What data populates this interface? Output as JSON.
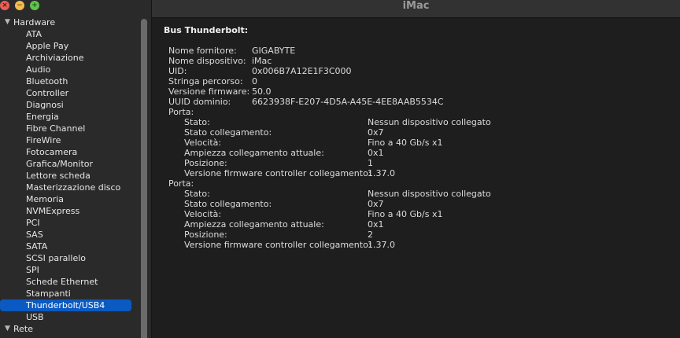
{
  "window": {
    "title": "iMac",
    "traffic": {
      "close": "×",
      "min": "−",
      "max": "+"
    }
  },
  "sidebar": {
    "hardware_label": "Hardware",
    "items": [
      "ATA",
      "Apple Pay",
      "Archiviazione",
      "Audio",
      "Bluetooth",
      "Controller",
      "Diagnosi",
      "Energia",
      "Fibre Channel",
      "FireWire",
      "Fotocamera",
      "Grafica/Monitor",
      "Lettore scheda",
      "Masterizzazione disco",
      "Memoria",
      "NVMExpress",
      "PCI",
      "SAS",
      "SATA",
      "SCSI parallelo",
      "SPI",
      "Schede Ethernet",
      "Stampanti",
      "Thunderbolt/USB4",
      "USB"
    ],
    "selected_index": 23,
    "rete_label": "Rete"
  },
  "detail": {
    "section_title": "Bus Thunderbolt:",
    "bus": [
      {
        "label": "Nome fornitore:",
        "value": "GIGABYTE"
      },
      {
        "label": "Nome dispositivo:",
        "value": "iMac"
      },
      {
        "label": "UID:",
        "value": "0x006B7A12E1F3C000"
      },
      {
        "label": "Stringa percorso:",
        "value": "0"
      },
      {
        "label": "Versione firmware:",
        "value": "50.0"
      },
      {
        "label": "UUID dominio:",
        "value": "6623938F-E207-4D5A-A45E-4EE8AAB5534C"
      }
    ],
    "ports": [
      {
        "label": "Porta:",
        "fields": [
          {
            "label": "Stato:",
            "value": "Nessun dispositivo collegato"
          },
          {
            "label": "Stato collegamento:",
            "value": "0x7"
          },
          {
            "label": "Velocità:",
            "value": "Fino a 40 Gb/s x1"
          },
          {
            "label": "Ampiezza collegamento attuale:",
            "value": "0x1"
          },
          {
            "label": "Posizione:",
            "value": "1"
          },
          {
            "label": "Versione firmware controller collegamento:",
            "value": "1.37.0"
          }
        ]
      },
      {
        "label": "Porta:",
        "fields": [
          {
            "label": "Stato:",
            "value": "Nessun dispositivo collegato"
          },
          {
            "label": "Stato collegamento:",
            "value": "0x7"
          },
          {
            "label": "Velocità:",
            "value": "Fino a 40 Gb/s x1"
          },
          {
            "label": "Ampiezza collegamento attuale:",
            "value": "0x1"
          },
          {
            "label": "Posizione:",
            "value": "2"
          },
          {
            "label": "Versione firmware controller collegamento:",
            "value": "1.37.0"
          }
        ]
      }
    ]
  },
  "colors": {
    "selection": "#0a5ac2",
    "background": "#1e1e1e",
    "sidebar": "#2b2a2b"
  },
  "icons": {
    "close": "close-icon",
    "minimize": "minimize-icon",
    "zoom": "zoom-icon",
    "disclosure": "chevron-down-icon"
  }
}
